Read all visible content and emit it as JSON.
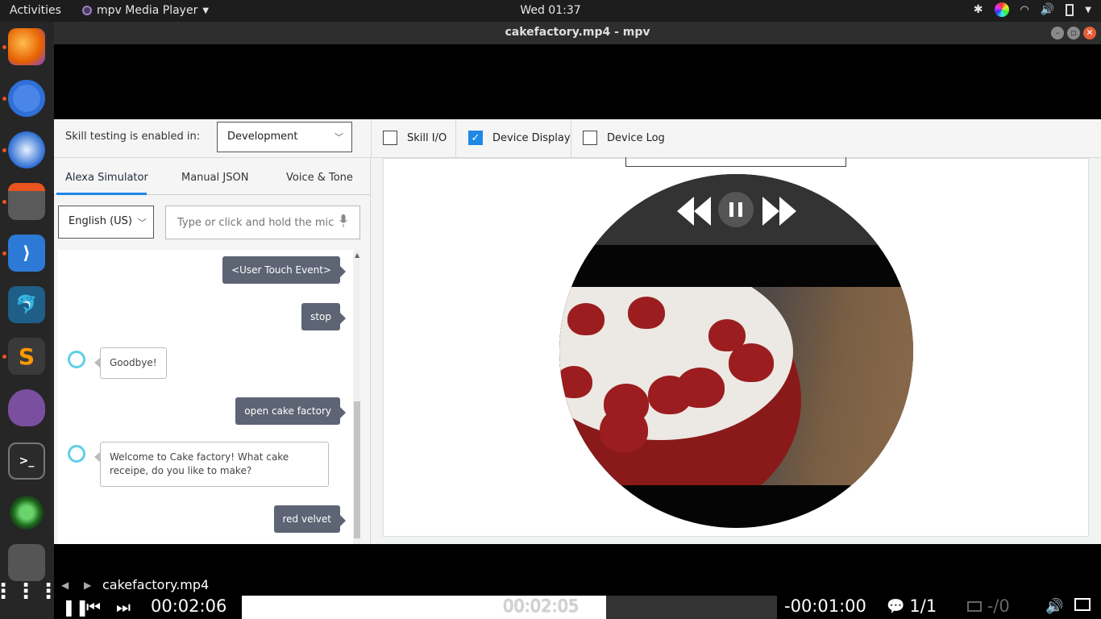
{
  "topbar": {
    "activities": "Activities",
    "app_name": "mpv Media Player",
    "clock": "Wed 01:37"
  },
  "window": {
    "title": "cakefactory.mp4 - mpv"
  },
  "console": {
    "skill_testing_label": "Skill testing is enabled in:",
    "stage_select": "Development",
    "checkboxes": [
      {
        "label": "Skill I/O",
        "checked": false
      },
      {
        "label": "Device Display",
        "checked": true
      },
      {
        "label": "Device Log",
        "checked": false
      }
    ],
    "tabs": [
      "Alexa Simulator",
      "Manual JSON",
      "Voice & Tone"
    ],
    "active_tab": "Alexa Simulator",
    "language": "English (US)",
    "utterance_placeholder": "Type or click and hold the mic",
    "chat": [
      {
        "from": "user",
        "text": "<User Touch Event>"
      },
      {
        "from": "user",
        "text": "stop"
      },
      {
        "from": "alexa",
        "text": "Goodbye!"
      },
      {
        "from": "user",
        "text": "open cake factory"
      },
      {
        "from": "alexa",
        "text": "Welcome to Cake factory! What cake receipe, do you like to make?"
      },
      {
        "from": "user",
        "text": "red velvet"
      }
    ]
  },
  "player": {
    "filename": "cakefactory.mp4",
    "elapsed": "00:02:06",
    "hover_time": "00:02:05",
    "remaining": "-00:01:00",
    "subtitle_track": "1/1",
    "second_sub": "-/0",
    "progress": 0.68
  },
  "colors": {
    "accent_blue": "#1e88e5",
    "user_bubble": "#5d6474",
    "alexa_ring": "#5fcfe8"
  }
}
